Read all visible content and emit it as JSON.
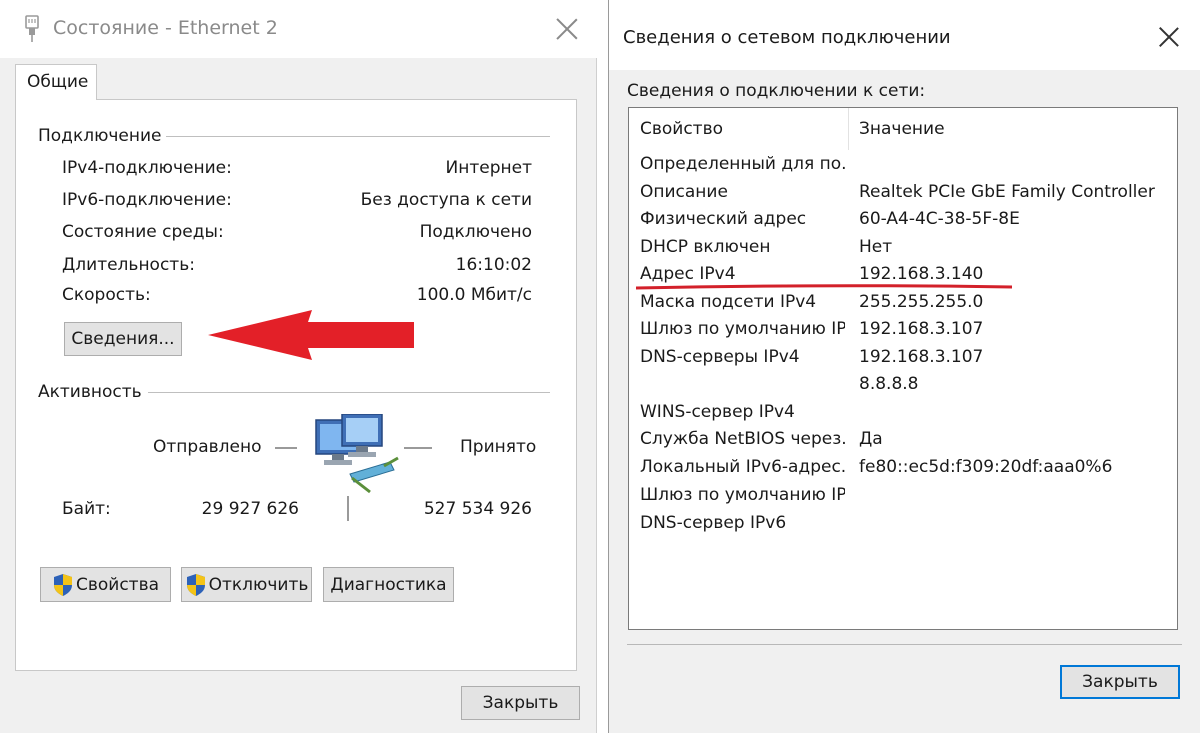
{
  "status_dialog": {
    "title": "Состояние - Ethernet 2",
    "tab": "Общие",
    "connection_group": "Подключение",
    "rows": [
      {
        "key": "IPv4-подключение:",
        "value": "Интернет"
      },
      {
        "key": "IPv6-подключение:",
        "value": "Без доступа к сети"
      },
      {
        "key": "Состояние среды:",
        "value": "Подключено"
      },
      {
        "key": "Длительность:",
        "value": "16:10:02"
      },
      {
        "key": "Скорость:",
        "value": "100.0 Мбит/с"
      }
    ],
    "details_button": "Сведения...",
    "activity_group": "Активность",
    "sent_label": "Отправлено",
    "received_label": "Принято",
    "bytes_label": "Байт:",
    "bytes_sent": "29 927 626",
    "bytes_received": "527 534 926",
    "buttons": {
      "properties": "Свойства",
      "disable": "Отключить",
      "diagnose": "Диагностика"
    },
    "close_button": "Закрыть",
    "icons": {
      "app": "ethernet-plug-icon",
      "network": "network-computers-icon",
      "shield": "uac-shield-icon"
    }
  },
  "details_dialog": {
    "title": "Сведения о сетевом подключении",
    "caption": "Сведения о подключении к сети:",
    "columns": [
      "Свойство",
      "Значение"
    ],
    "rows": [
      {
        "property": "Определенный для по...",
        "value": ""
      },
      {
        "property": "Описание",
        "value": "Realtek PCIe GbE Family Controller"
      },
      {
        "property": "Физический адрес",
        "value": "60-A4-4C-38-5F-8E"
      },
      {
        "property": "DHCP включен",
        "value": "Нет"
      },
      {
        "property": "Адрес IPv4",
        "value": "192.168.3.140"
      },
      {
        "property": "Маска подсети IPv4",
        "value": "255.255.255.0"
      },
      {
        "property": "Шлюз по умолчанию IP...",
        "value": "192.168.3.107"
      },
      {
        "property": "DNS-серверы IPv4",
        "value": "192.168.3.107"
      },
      {
        "property": "",
        "value": "8.8.8.8"
      },
      {
        "property": "WINS-сервер IPv4",
        "value": ""
      },
      {
        "property": "Служба NetBIOS через...",
        "value": "Да"
      },
      {
        "property": "Локальный IPv6-адрес...",
        "value": "fe80::ec5d:f309:20df:aaa0%6"
      },
      {
        "property": "Шлюз по умолчанию IP...",
        "value": ""
      },
      {
        "property": "DNS-сервер IPv6",
        "value": ""
      }
    ],
    "close_button": "Закрыть"
  },
  "annotations": {
    "arrow_color": "#e32028",
    "underline_color": "#d3202a"
  },
  "colors": {
    "focus_border": "#0078d7",
    "dialog_bg": "#f0f0f0",
    "button_bg": "#e3e3e3"
  }
}
